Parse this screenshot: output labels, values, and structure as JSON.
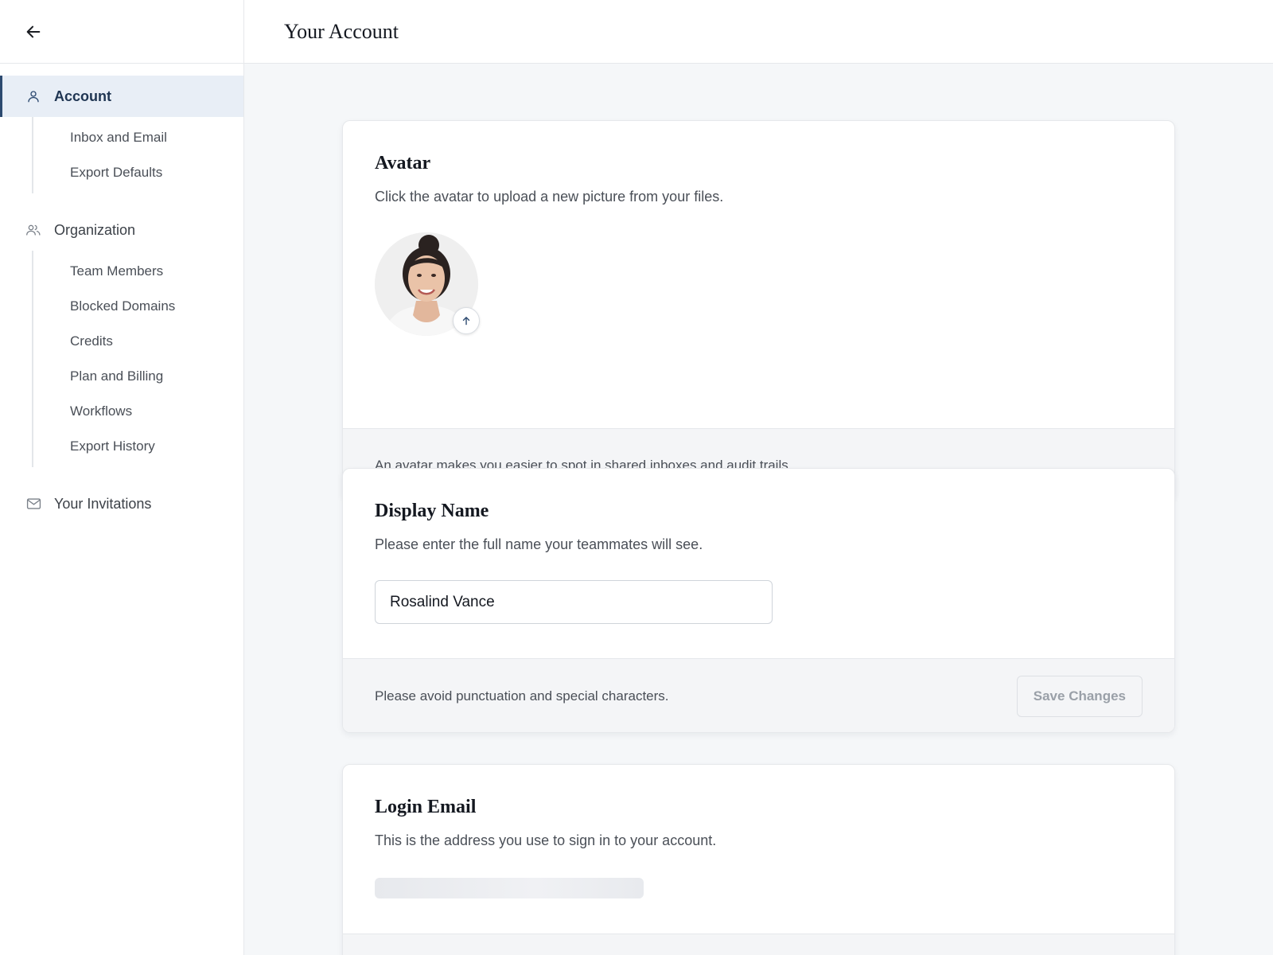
{
  "header": {
    "title": "Your Account"
  },
  "sidebar": {
    "account": {
      "label": "Account",
      "icon": "user-icon",
      "items": [
        "Inbox and Email",
        "Export Defaults"
      ]
    },
    "organization": {
      "label": "Organization",
      "icon": "users-icon",
      "items": [
        "Team Members",
        "Blocked Domains",
        "Credits",
        "Plan and Billing",
        "Workflows",
        "Export History"
      ]
    },
    "invitations": {
      "label": "Your Invitations",
      "icon": "mail-icon"
    }
  },
  "avatar_card": {
    "title": "Avatar",
    "description": "Click the avatar to upload a new picture from your files.",
    "footer": "An avatar makes you easier to spot in shared inboxes and audit trails."
  },
  "display_name_card": {
    "title": "Display Name",
    "description": "Please enter the full name your teammates will see.",
    "value": "Rosalind Vance",
    "footer": "Please avoid punctuation and special characters.",
    "save_label": "Save Changes"
  },
  "login_email_card": {
    "title": "Login Email",
    "description": "This is the address you use to sign in to your account."
  },
  "colors": {
    "accent": "#2d4a70",
    "active_bg": "#e8eef6"
  }
}
